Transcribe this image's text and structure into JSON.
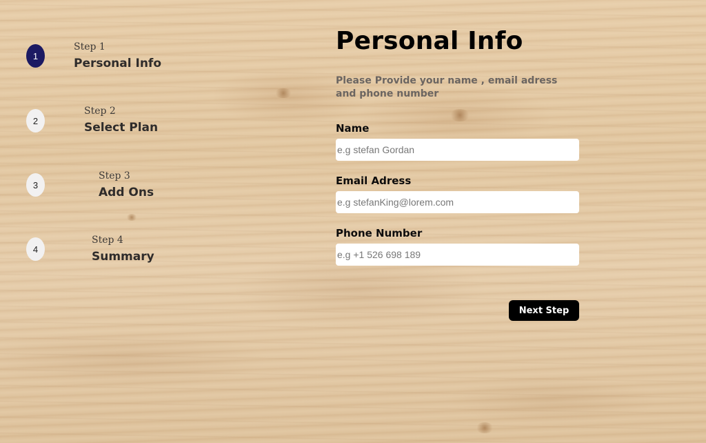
{
  "sidebar": {
    "steps": [
      {
        "number": "1",
        "kicker": "Step 1",
        "title": "Personal Info",
        "active": true
      },
      {
        "number": "2",
        "kicker": "Step 2",
        "title": "Select Plan",
        "active": false
      },
      {
        "number": "3",
        "kicker": "Step 3",
        "title": "Add Ons",
        "active": false
      },
      {
        "number": "4",
        "kicker": "Step 4",
        "title": "Summary",
        "active": false
      }
    ]
  },
  "form": {
    "title": "Personal Info",
    "subtitle": "Please Provide your name , email adress and phone number",
    "fields": {
      "name": {
        "label": "Name",
        "value": "",
        "placeholder": "e.g stefan Gordan"
      },
      "email": {
        "label": "Email Adress",
        "value": "",
        "placeholder": "e.g stefanKing@lorem.com"
      },
      "phone": {
        "label": "Phone Number",
        "value": "",
        "placeholder": "e.g +1 526 698 189"
      }
    },
    "next_label": "Next Step"
  },
  "colors": {
    "active_step": "#1c1a63",
    "inactive_step": "#f2f1f1",
    "button": "#000000",
    "background_wood": "#e3c9a5"
  }
}
